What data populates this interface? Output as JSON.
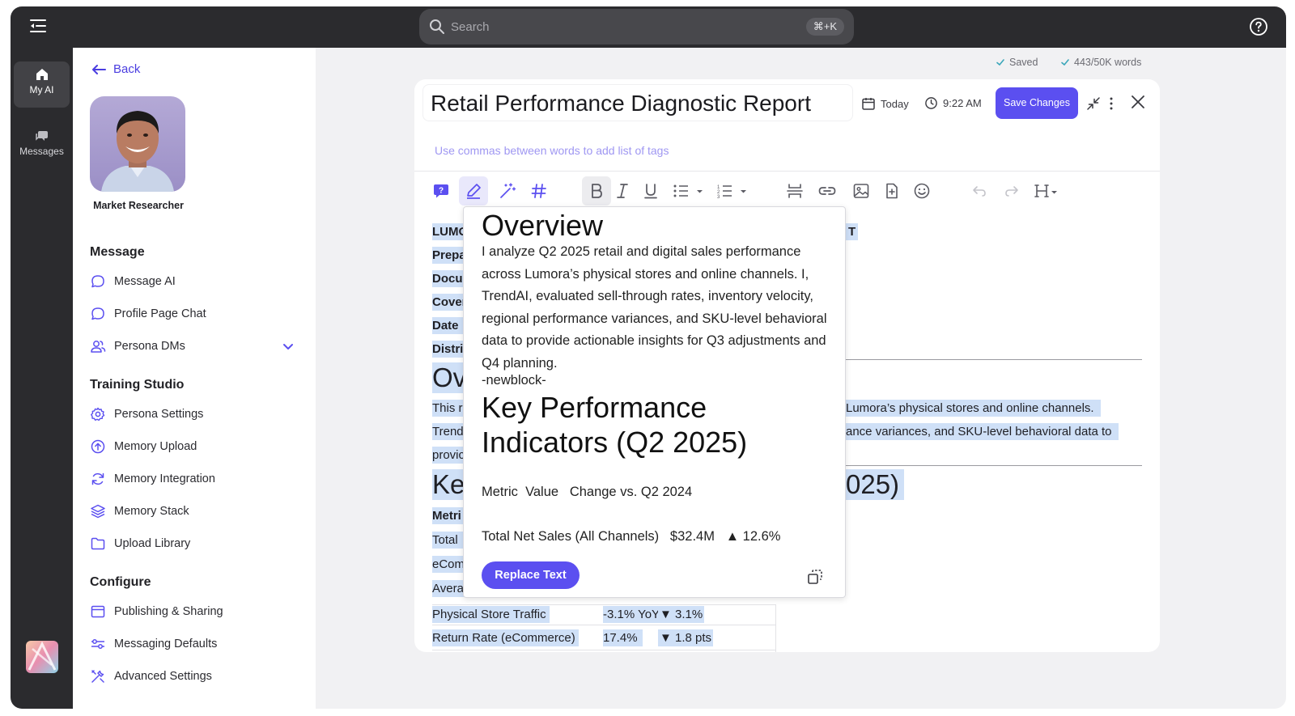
{
  "topbar": {
    "search_placeholder": "Search",
    "shortcut": "⌘+K"
  },
  "rail": {
    "items": [
      {
        "label": "My AI",
        "icon": "home-icon",
        "active": true
      },
      {
        "label": "Messages",
        "icon": "messages-icon",
        "active": false
      }
    ]
  },
  "sidebar": {
    "back_label": "Back",
    "persona_name": "Market Researcher",
    "sections": [
      {
        "title": "Message",
        "items": [
          {
            "label": "Message AI",
            "icon": "chat-bubble-icon"
          },
          {
            "label": "Profile Page Chat",
            "icon": "chat-bubble-icon"
          },
          {
            "label": "Persona DMs",
            "icon": "users-icon",
            "expandable": true
          }
        ]
      },
      {
        "title": "Training Studio",
        "items": [
          {
            "label": "Persona Settings",
            "icon": "gear-icon"
          },
          {
            "label": "Memory Upload",
            "icon": "upload-circle-icon"
          },
          {
            "label": "Memory Integration",
            "icon": "sync-icon"
          },
          {
            "label": "Memory Stack",
            "icon": "layers-icon"
          },
          {
            "label": "Upload Library",
            "icon": "folder-icon"
          }
        ]
      },
      {
        "title": "Configure",
        "items": [
          {
            "label": "Publishing & Sharing",
            "icon": "window-icon"
          },
          {
            "label": "Messaging Defaults",
            "icon": "sliders-icon"
          },
          {
            "label": "Advanced Settings",
            "icon": "tools-icon"
          }
        ]
      }
    ]
  },
  "status": {
    "saved": "Saved",
    "word_count": "443/50K words"
  },
  "editor": {
    "title": "Retail Performance Diagnostic Report",
    "date_label": "Today",
    "time_label": "9:22 AM",
    "save_button": "Save Changes",
    "tags_placeholder": "Use commas between words to add list of tags"
  },
  "document": {
    "left_fragments": [
      "LUMO",
      "Prepa",
      "Docu",
      "Cover",
      "Date",
      "Distri"
    ],
    "fragment_t": "T",
    "overview_fragment": "Ov",
    "overview_lines_left": [
      "This r",
      "Trend",
      "provic"
    ],
    "overview_lines_right": [
      "Lumora’s physical stores and online channels.",
      "ance variances, and SKU-level behavioral data to"
    ],
    "kpi_fragment_left": "Ke",
    "kpi_fragment_right": "025)",
    "table_fragments": [
      "Metri",
      "Total",
      "eCom",
      "Avera"
    ],
    "rows": [
      {
        "metric": "Physical Store Traffic",
        "value": "-3.1% YoY",
        "change": "▼ 3.1%"
      },
      {
        "metric": "Return Rate (eCommerce)",
        "value": "17.4%",
        "change": "▼ 1.8 pts"
      }
    ]
  },
  "popup": {
    "heading1": "Overview",
    "paragraph": "I analyze Q2 2025 retail and digital sales performance across Lumora’s physical stores and online channels. I, TrendAI, evaluated sell-through rates, inventory velocity, regional performance variances, and SKU-level behavioral data to provide actionable insights for Q3 adjustments and Q4 planning.",
    "separator": "-newblock-",
    "heading2": "Key Performance Indicators (Q2 2025)",
    "header_row": "Metric  Value   Change vs. Q2 2024",
    "data_row": "Total Net Sales (All Channels)   $32.4M   ▲ 12.6%",
    "replace_button": "Replace Text"
  },
  "colors": {
    "accent": "#5b4ff0",
    "dark": "#2b2b2e",
    "highlight": "#cfe0f7"
  }
}
